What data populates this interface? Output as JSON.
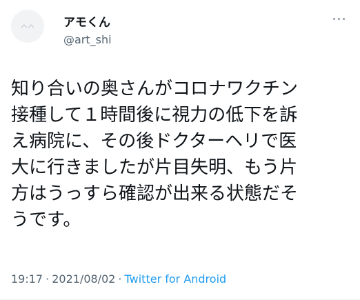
{
  "author": {
    "display_name": "アモくん",
    "handle": "@art_shi"
  },
  "tweet": {
    "text": "知り合いの奥さんがコロナワクチン\n接種して１時間後に視力の低下を訴\nえ病院に、その後ドクターヘリで医\n大に行きましたが片目失明、もう片\n方はうっすら確認が出来る状態だそ\nうです。",
    "time": "19:17",
    "date": "2021/08/02",
    "separator": "·",
    "source": "Twitter for Android"
  },
  "icons": {
    "more": "more-horizontal-icon",
    "avatar": "avatar-image"
  }
}
